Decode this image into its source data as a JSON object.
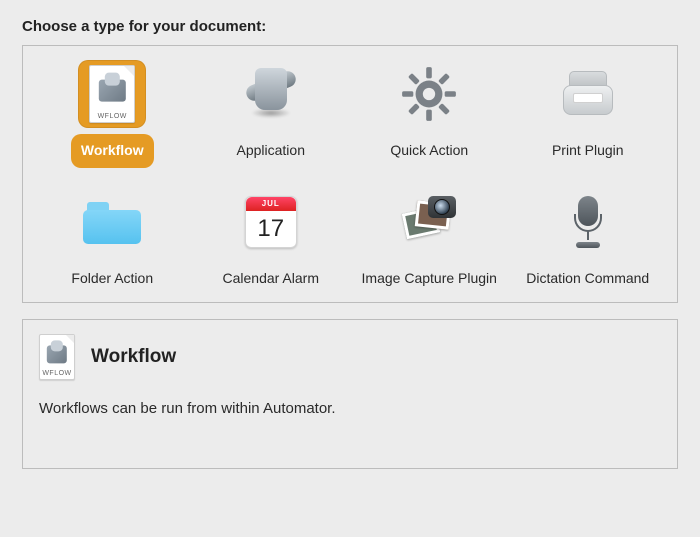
{
  "heading": "Choose a type for your document:",
  "wflow_ext": "WFLOW",
  "calendar": {
    "month": "JUL",
    "day": "17"
  },
  "types": [
    {
      "label": "Workflow",
      "selected": true
    },
    {
      "label": "Application",
      "selected": false
    },
    {
      "label": "Quick Action",
      "selected": false
    },
    {
      "label": "Print Plugin",
      "selected": false
    },
    {
      "label": "Folder Action",
      "selected": false
    },
    {
      "label": "Calendar Alarm",
      "selected": false
    },
    {
      "label": "Image Capture Plugin",
      "selected": false
    },
    {
      "label": "Dictation Command",
      "selected": false
    }
  ],
  "detail": {
    "title": "Workflow",
    "description": "Workflows can be run from within Automator."
  }
}
